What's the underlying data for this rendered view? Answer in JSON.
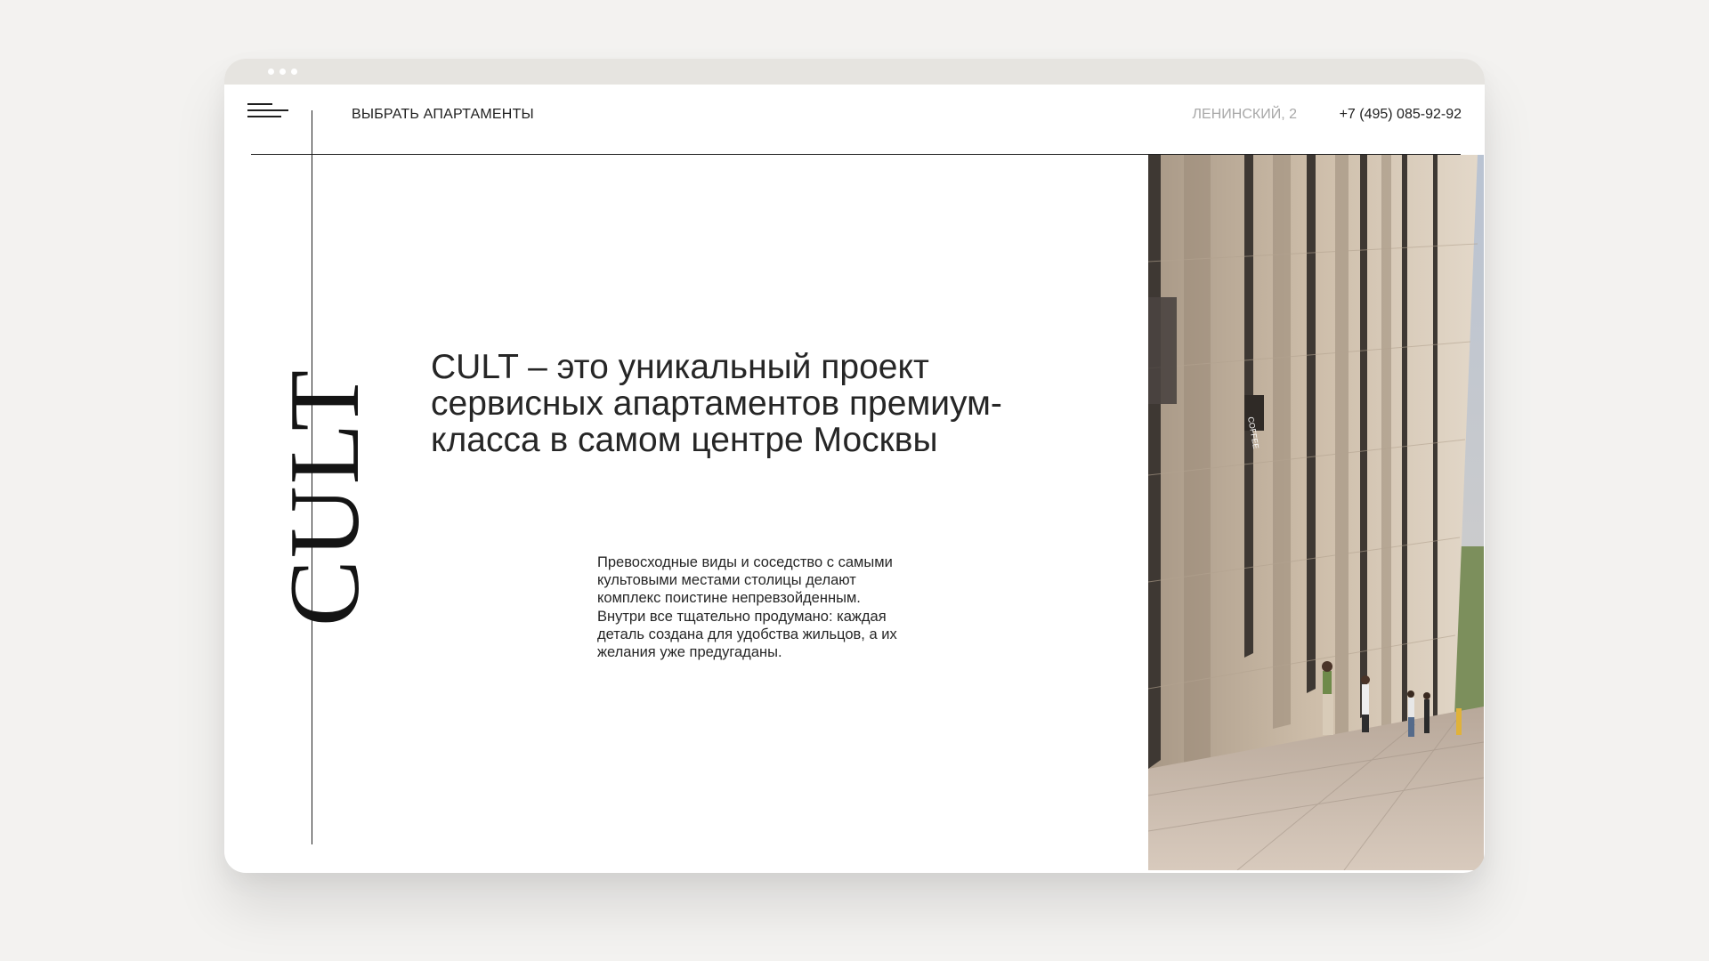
{
  "header": {
    "menu_icon": "hamburger-menu-icon",
    "nav_link": "ВЫБРАТЬ АПАРТАМЕНТЫ",
    "address": "ЛЕНИНСКИЙ, 2",
    "phone": "+7 (495) 085-92-92"
  },
  "brand": {
    "logo": "CULT"
  },
  "hero": {
    "headline": "CULT – это уникальный проект сервисных апартаментов премиум-класса в самом центре Москвы",
    "description": "Превосходные виды и соседство с самыми культовыми местами столицы делают комплекс поистине непревзойденным. Внутри все тщательно продумано: каждая деталь создана для удобства жильцов, а их желания уже предугаданы.",
    "image": "building-facade-photo",
    "sign": "COFFEE"
  },
  "colors": {
    "page_background": "#f3f2f0",
    "titlebar": "#e6e4e0",
    "text": "#1f1f1f",
    "muted": "#a8a8a8"
  }
}
